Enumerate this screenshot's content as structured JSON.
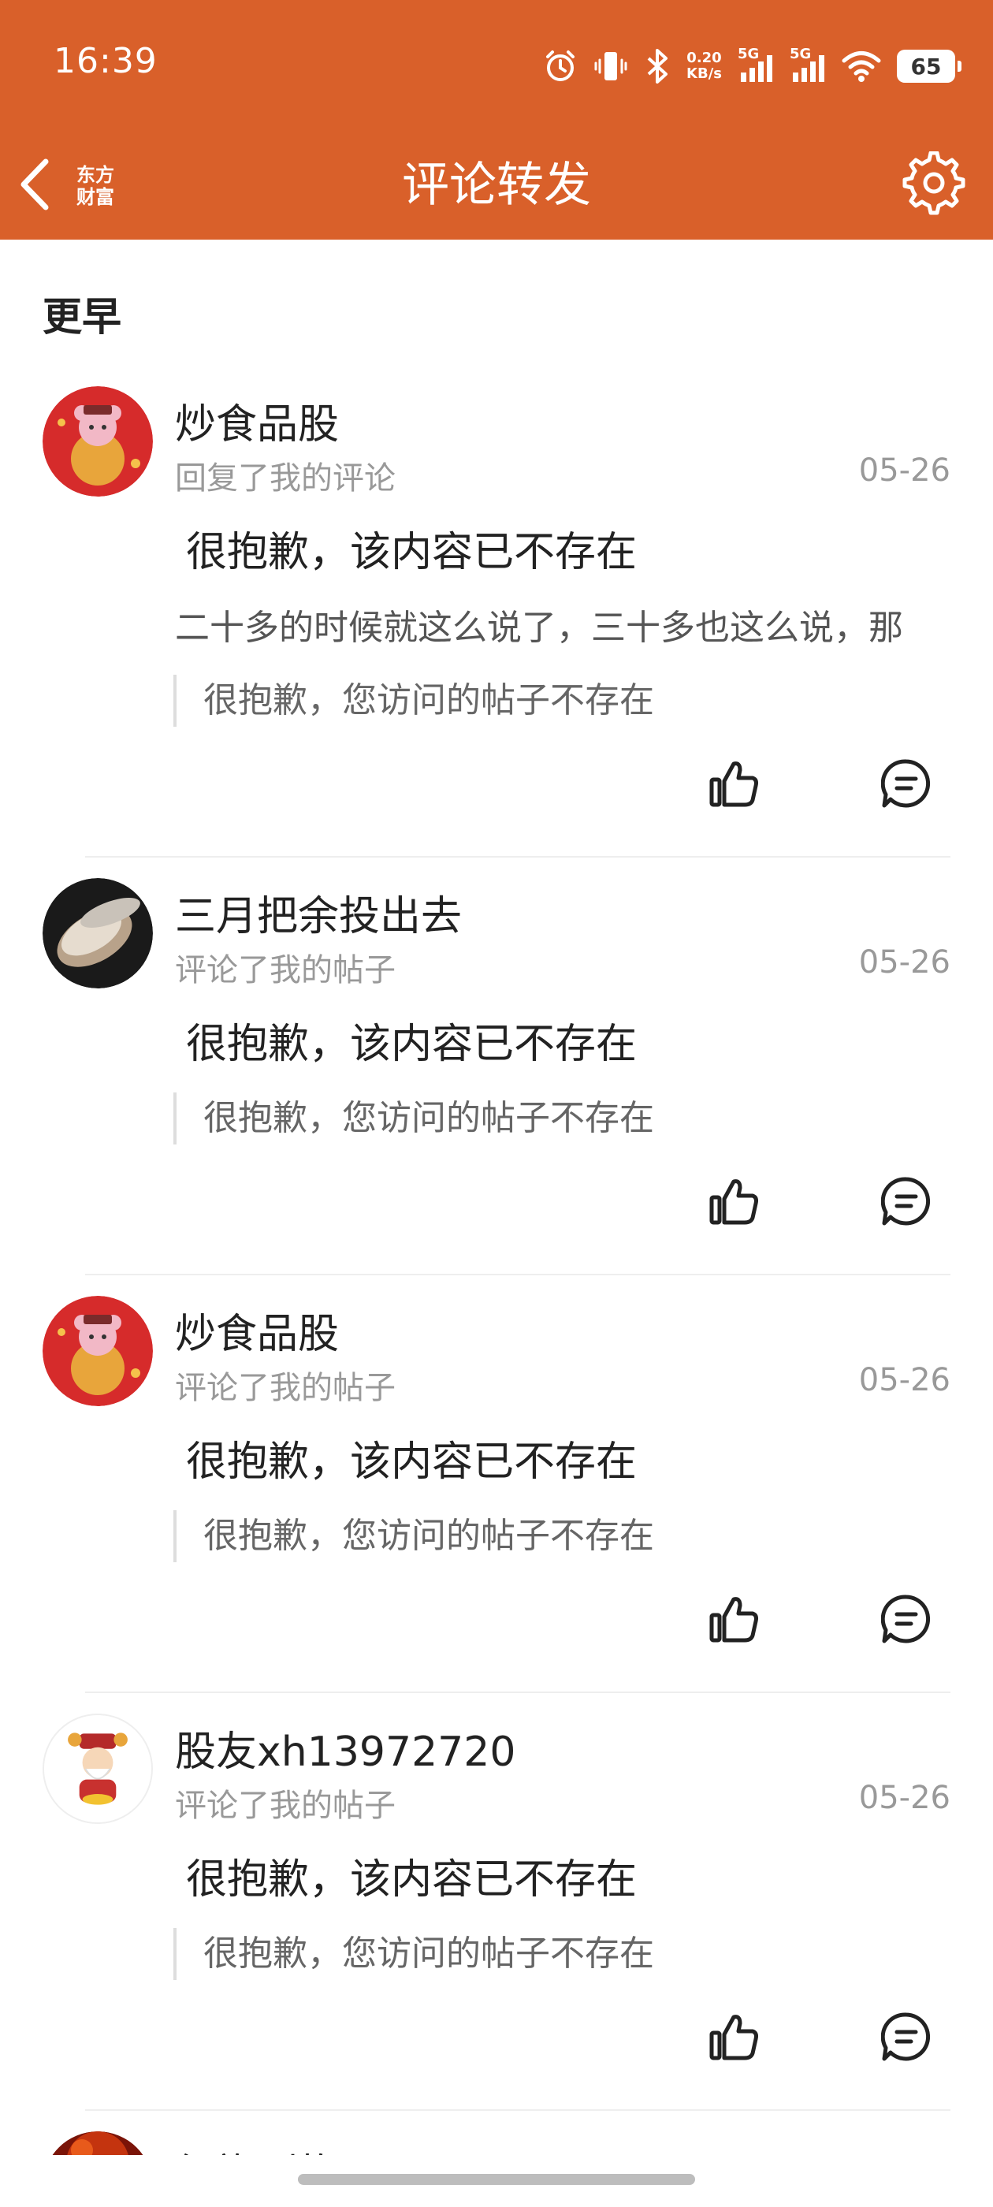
{
  "colors": {
    "header": "#D9602A",
    "text_primary": "#222222",
    "text_secondary": "#999999",
    "divider": "#eeeeee"
  },
  "status_bar": {
    "time": "16:39",
    "net_speed_value": "0.20",
    "net_speed_unit": "KB/s",
    "signal_1": "5G",
    "signal_2": "5G",
    "battery": "65",
    "icons": [
      "alarm-icon",
      "vibrate-icon",
      "bluetooth-icon",
      "signal-icon",
      "signal-icon",
      "wifi-icon",
      "battery-icon"
    ]
  },
  "nav": {
    "logo_line1": "东方",
    "logo_line2": "财富",
    "title": "评论转发"
  },
  "section_title": "更早",
  "items": [
    {
      "user": "炒食品股",
      "action": "回复了我的评论",
      "date": "05-26",
      "title": "很抱歉，该内容已不存在",
      "body": "二十多的时候就这么说了，三十多也这么说，那",
      "quote": "很抱歉，您访问的帖子不存在",
      "avatar": "rat-god-avatar"
    },
    {
      "user": "三月把余投出去",
      "action": "评论了我的帖子",
      "date": "05-26",
      "title": "很抱歉，该内容已不存在",
      "quote": "很抱歉，您访问的帖子不存在",
      "avatar": "bowl-avatar"
    },
    {
      "user": "炒食品股",
      "action": "评论了我的帖子",
      "date": "05-26",
      "title": "很抱歉，该内容已不存在",
      "quote": "很抱歉，您访问的帖子不存在",
      "avatar": "rat-god-avatar"
    },
    {
      "user": "股友xh13972720",
      "action": "评论了我的帖子",
      "date": "05-26",
      "title": "很抱歉，该内容已不存在",
      "quote": "很抱歉，您访问的帖子不存在",
      "avatar": "fortune-god-avatar"
    },
    {
      "user": "红旗到炸",
      "avatar": "fire-avatar"
    }
  ]
}
